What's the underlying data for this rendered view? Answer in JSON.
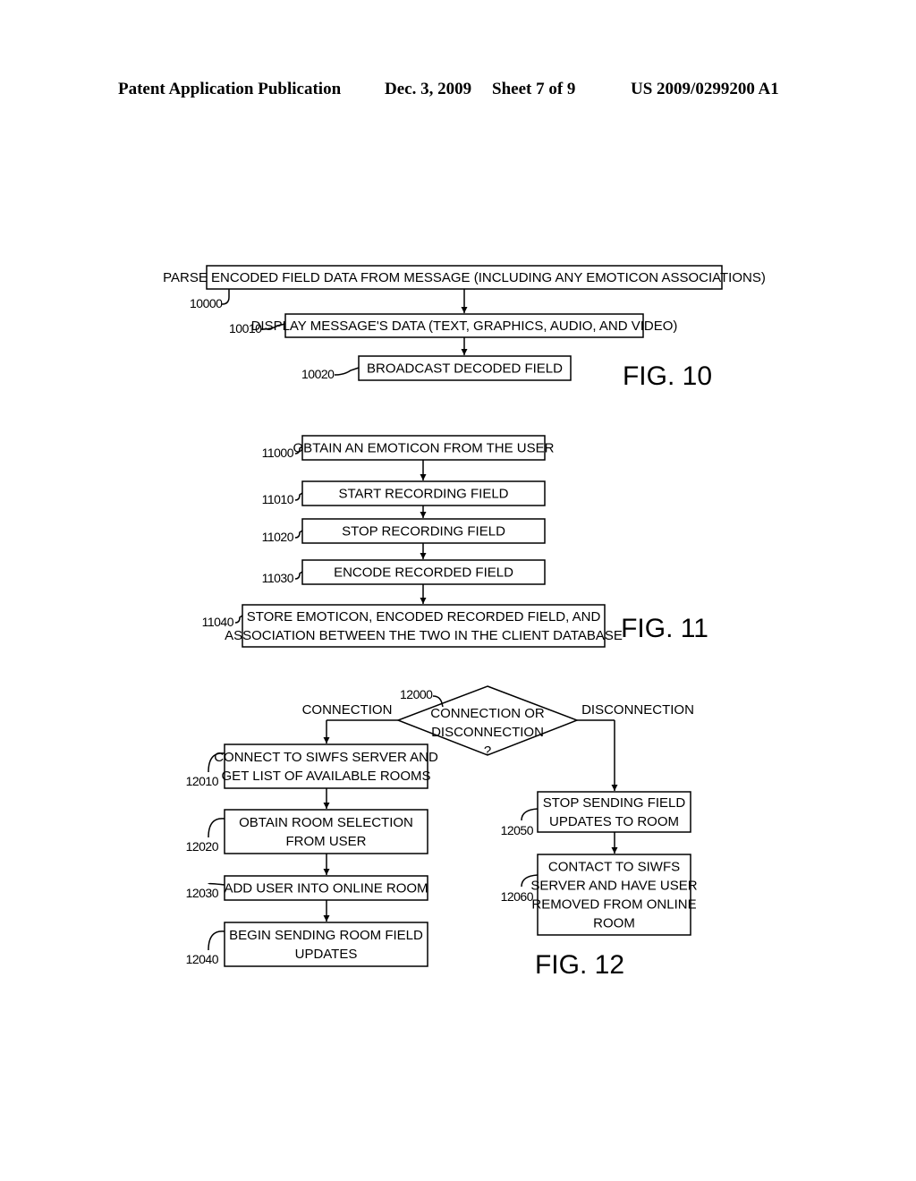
{
  "header": {
    "left": "Patent Application Publication",
    "date": "Dec. 3, 2009",
    "sheet": "Sheet 7 of 9",
    "number": "US 2009/0299200 A1"
  },
  "fig10": {
    "label": "FIG. 10",
    "steps": [
      {
        "ref": "10000",
        "lines": [
          "PARSE ENCODED FIELD DATA FROM MESSAGE (INCLUDING ANY EMOTICON ASSOCIATIONS)"
        ]
      },
      {
        "ref": "10010",
        "lines": [
          "DISPLAY MESSAGE'S DATA (TEXT, GRAPHICS, AUDIO, AND VIDEO)"
        ]
      },
      {
        "ref": "10020",
        "lines": [
          "BROADCAST DECODED FIELD"
        ]
      }
    ]
  },
  "fig11": {
    "label": "FIG. 11",
    "steps": [
      {
        "ref": "11000",
        "lines": [
          "OBTAIN AN EMOTICON FROM THE USER"
        ]
      },
      {
        "ref": "11010",
        "lines": [
          "START RECORDING FIELD"
        ]
      },
      {
        "ref": "11020",
        "lines": [
          "STOP RECORDING FIELD"
        ]
      },
      {
        "ref": "11030",
        "lines": [
          "ENCODE RECORDED FIELD"
        ]
      },
      {
        "ref": "11040",
        "lines": [
          "STORE EMOTICON, ENCODED RECORDED FIELD, AND",
          "ASSOCIATION BETWEEN THE TWO IN THE CLIENT DATABASE"
        ]
      }
    ]
  },
  "fig12": {
    "label": "FIG. 12",
    "decision": {
      "ref": "12000",
      "lines": [
        "CONNECTION OR",
        "DISCONNECTION",
        "?"
      ]
    },
    "branch_left": "CONNECTION",
    "branch_right": "DISCONNECTION",
    "left_steps": [
      {
        "ref": "12010",
        "lines": [
          "CONNECT TO SIWFS SERVER AND",
          "GET LIST OF AVAILABLE ROOMS"
        ]
      },
      {
        "ref": "12020",
        "lines": [
          "OBTAIN ROOM SELECTION",
          "FROM USER"
        ]
      },
      {
        "ref": "12030",
        "lines": [
          "ADD USER INTO ONLINE ROOM"
        ]
      },
      {
        "ref": "12040",
        "lines": [
          "BEGIN SENDING ROOM FIELD",
          "UPDATES"
        ]
      }
    ],
    "right_steps": [
      {
        "ref": "12050",
        "lines": [
          "STOP SENDING FIELD",
          "UPDATES TO ROOM"
        ]
      },
      {
        "ref": "12060",
        "lines": [
          "CONTACT TO SIWFS",
          "SERVER AND HAVE USER",
          "REMOVED FROM ONLINE",
          "ROOM"
        ]
      }
    ]
  }
}
